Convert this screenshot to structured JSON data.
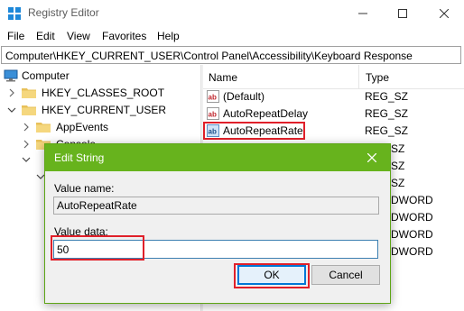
{
  "window": {
    "title": "Registry Editor",
    "minimize_icon": "minimize-icon",
    "maximize_icon": "maximize-icon",
    "close_icon": "close-icon"
  },
  "menu": [
    "File",
    "Edit",
    "View",
    "Favorites",
    "Help"
  ],
  "address": "Computer\\HKEY_CURRENT_USER\\Control Panel\\Accessibility\\Keyboard Response",
  "tree": {
    "root": "Computer",
    "items": [
      {
        "label": "HKEY_CLASSES_ROOT",
        "expanded": false
      },
      {
        "label": "HKEY_CURRENT_USER",
        "expanded": true
      },
      {
        "label": "AppEvents",
        "expanded": false
      },
      {
        "label": "Console",
        "expanded": false
      }
    ]
  },
  "list": {
    "headers": {
      "name": "Name",
      "type": "Type"
    },
    "rows": [
      {
        "name": "(Default)",
        "type": "REG_SZ",
        "icon": "string-value-icon"
      },
      {
        "name": "AutoRepeatDelay",
        "type": "REG_SZ",
        "icon": "string-value-icon"
      },
      {
        "name": "AutoRepeatRate",
        "type": "REG_SZ",
        "icon": "string-value-icon"
      }
    ],
    "partial_types": [
      "SZ",
      "SZ",
      "SZ",
      "DWORD",
      "DWORD",
      "DWORD",
      "DWORD"
    ]
  },
  "dialog": {
    "title": "Edit String",
    "value_name_label": "Value name:",
    "value_name": "AutoRepeatRate",
    "value_data_label": "Value data:",
    "value_data": "50",
    "ok_label": "OK",
    "cancel_label": "Cancel"
  },
  "colors": {
    "dialog_accent": "#67b31d",
    "highlight": "#e0202a"
  }
}
